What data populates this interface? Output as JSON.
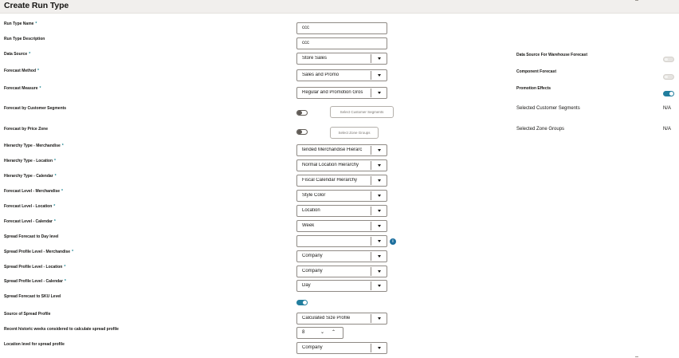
{
  "page": {
    "title": "Create Run Type"
  },
  "fields": {
    "run_type_name": {
      "label": "Run Type Name",
      "value": "ccc"
    },
    "run_type_description": {
      "label": "Run Type Description",
      "value": "ccc"
    },
    "data_source": {
      "label": "Data Source",
      "value": "Store Sales"
    },
    "forecast_method": {
      "label": "Forecast Method",
      "value": "Sales and Promo"
    },
    "forecast_measure": {
      "label": "Forecast Measure",
      "value": "Regular and Promotion Gros"
    },
    "forecast_customer_segments": {
      "label": "Forecast by Customer Segments",
      "toggle": "off",
      "button": "Select Customer Segments"
    },
    "forecast_price_zone": {
      "label": "Forecast by Price Zone",
      "toggle": "off",
      "button": "Select Zone Groups"
    },
    "hierarchy_merchandise": {
      "label": "Hierarchy Type - Merchandise",
      "value": "tended Merchandise Hierarc"
    },
    "hierarchy_location": {
      "label": "Hierarchy Type - Location",
      "value": "Normal Location Hierarchy"
    },
    "hierarchy_calendar": {
      "label": "Hierarchy Type - Calendar",
      "value": "Fiscal Calendar Hierarchy"
    },
    "level_merchandise": {
      "label": "Forecast Level - Merchandise",
      "value": "Style Color"
    },
    "level_location": {
      "label": "Forecast Level - Location",
      "value": "Location"
    },
    "level_calendar": {
      "label": "Forecast Level - Calendar",
      "value": "Week"
    },
    "spread_day_level": {
      "label": "Spread Forecast to Day level",
      "value": ""
    },
    "spread_merchandise": {
      "label": "Spread Profile Level - Merchandise",
      "value": "Company"
    },
    "spread_location": {
      "label": "Spread Profile Level - Location",
      "value": "Company"
    },
    "spread_calendar": {
      "label": "Spread Profile Level - Calendar",
      "value": "Day"
    },
    "spread_sku": {
      "label": "Spread Forecast to SKU Level",
      "toggle": "on"
    },
    "spread_source": {
      "label": "Source of Spread Profile",
      "value": "Calculated Size Profile"
    },
    "historic_weeks": {
      "label": "Recent historic weeks considered to calculate spread profile",
      "value": "8"
    },
    "location_level_spread": {
      "label": "Location level for spread profile",
      "value": "Company"
    }
  },
  "right": {
    "warehouse_forecast": {
      "label": "Data Source For Warehouse Forecast",
      "toggle": "disabled-off"
    },
    "component_forecast": {
      "label": "Component Forecast",
      "toggle": "disabled-off"
    },
    "promotion_effects": {
      "label": "Promotion Effects",
      "toggle": "on"
    },
    "selected_customer_segments": {
      "label": "Selected Customer Segments",
      "value": "N/A"
    },
    "selected_zone_groups": {
      "label": "Selected Zone Groups",
      "value": "N/A"
    }
  },
  "required_marker": "*",
  "info_icon_glyph": "i",
  "stepper_down_glyph": "⌄",
  "stepper_up_glyph": "⌃",
  "colors": {
    "accent": "#227e9e",
    "required": "#1b8390",
    "header_bg": "#f1efed"
  },
  "icons": [
    "chevron-down-icon",
    "info-icon",
    "chevron-up-icon"
  ]
}
